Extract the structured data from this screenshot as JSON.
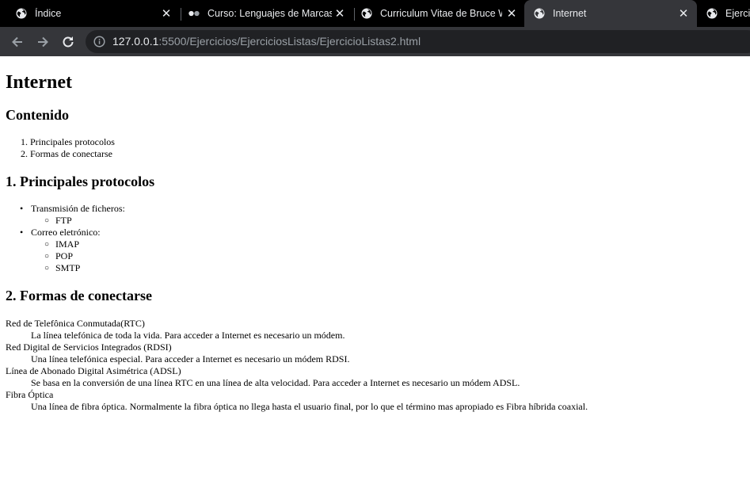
{
  "browser": {
    "tabs": [
      {
        "title": "Índice",
        "favicon": "globe-icon",
        "active": false
      },
      {
        "title": "Curso: Lenguajes de Marcas y",
        "favicon": "moodle-dots-icon",
        "active": false
      },
      {
        "title": "Curriculum Vitae de Bruce Wa",
        "favicon": "globe-icon",
        "active": false
      },
      {
        "title": "Internet",
        "favicon": "globe-icon",
        "active": true
      },
      {
        "title": "Ejercic",
        "favicon": "globe-icon",
        "active": false
      }
    ],
    "url_host": "127.0.0.1",
    "url_path": ":5500/Ejercicios/EjerciciosListas/EjercicioListas2.html",
    "colors": {
      "tab_strip": "#000000",
      "toolbar": "#35363a",
      "omnibox": "#202124"
    }
  },
  "page": {
    "title": "Internet",
    "contents_heading": "Contenido",
    "contents": [
      "Principales protocolos",
      "Formas de conectarse"
    ],
    "section1_heading": "1. Principales protocolos",
    "protocols": [
      {
        "label": "Transmisión de ficheros:",
        "items": [
          "FTP"
        ]
      },
      {
        "label": "Correo eletrónico:",
        "items": [
          "IMAP",
          "POP",
          "SMTP"
        ]
      }
    ],
    "section2_heading": "2. Formas de conectarse",
    "connections": [
      {
        "term": "Red de Telefônica Conmutada(RTC)",
        "desc": "La línea telefónica de toda la vida. Para acceder a Internet es necesario un módem."
      },
      {
        "term": "Red Digital de Servicios Integrados (RDSI)",
        "desc": "Una línea telefónica especial. Para acceder a Internet es necesario un módem RDSI."
      },
      {
        "term": "Línea de Abonado Digital Asimétrica (ADSL)",
        "desc": "Se basa en la conversión de una línea RTC en una línea de alta velocidad. Para acceder a Internet es necesario un módem ADSL."
      },
      {
        "term": "Fibra Óptica",
        "desc": "Una línea de fibra óptica. Normalmente la fibra óptica no llega hasta el usuario final, por lo que el término mas apropiado es Fibra híbrida coaxial."
      }
    ]
  }
}
